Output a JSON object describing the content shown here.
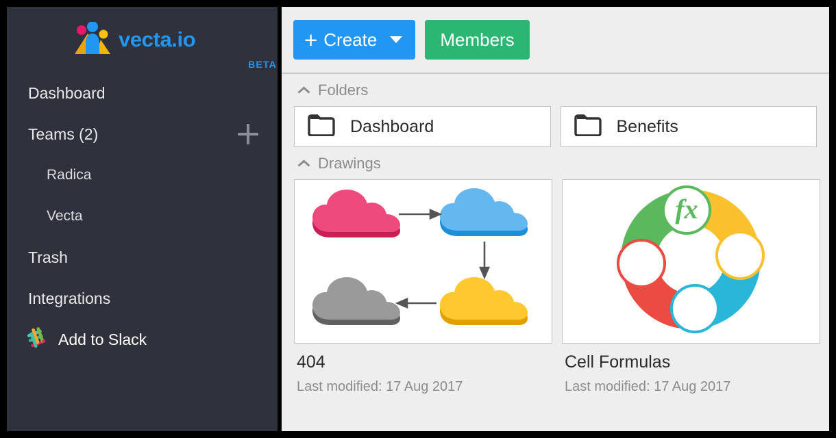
{
  "brand": {
    "name": "vecta.io",
    "badge": "BETA",
    "logo_icon": "vecta-people-logo-icon",
    "accent_blue": "#2196f3"
  },
  "sidebar": {
    "background": "#2f323c",
    "items": [
      {
        "label": "Dashboard",
        "level": "top",
        "name": "sidebar-item-dashboard"
      },
      {
        "label": "Teams (2)",
        "level": "group",
        "name": "sidebar-item-teams",
        "action_icon": "plus-icon"
      },
      {
        "label": "Radica",
        "level": "sub",
        "name": "sidebar-item-radica"
      },
      {
        "label": "Vecta",
        "level": "sub",
        "name": "sidebar-item-vecta"
      },
      {
        "label": "Trash",
        "level": "top",
        "name": "sidebar-item-trash"
      },
      {
        "label": "Integrations",
        "level": "top",
        "name": "sidebar-item-integrations"
      }
    ],
    "slack": {
      "label": "Add to Slack",
      "icon": "slack-icon"
    }
  },
  "toolbar": {
    "create_label": "Create",
    "create_plus": "+",
    "create_color": "#2196f3",
    "create_caret_icon": "chevron-down-icon",
    "members_label": "Members",
    "members_color": "#2bb673"
  },
  "main": {
    "sections": [
      {
        "title": "Folders",
        "toggle_icon": "chevron-up-icon"
      },
      {
        "title": "Drawings",
        "toggle_icon": "chevron-up-icon"
      }
    ],
    "folders": [
      {
        "name": "Dashboard",
        "icon": "folder-icon"
      },
      {
        "name": "Benefits",
        "icon": "folder-icon"
      }
    ],
    "drawings": [
      {
        "title": "404",
        "modified": "Last modified: 17 Aug 2017",
        "thumbnail": "cloud-flow-diagram",
        "colors": [
          "#ef4a7e",
          "#65b7f0",
          "#ffc82e",
          "#9a9a9a"
        ]
      },
      {
        "title": "Cell Formulas",
        "modified": "Last modified: 17 Aug 2017",
        "thumbnail": "four-segment-circle-diagram",
        "center_label": "fx",
        "colors": [
          "#5cb85c",
          "#fbc02d",
          "#29b6d8",
          "#ec4b42"
        ]
      }
    ]
  }
}
